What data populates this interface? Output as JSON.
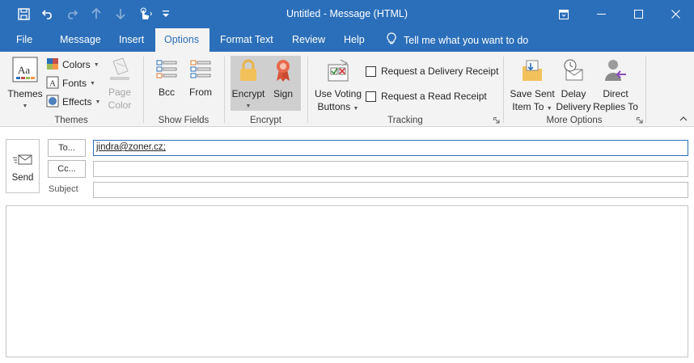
{
  "window": {
    "title": "Untitled  -  Message (HTML)"
  },
  "qat": {
    "icons": [
      "save-icon",
      "undo-icon",
      "redo-icon",
      "up-icon",
      "down-icon",
      "touch-mode-icon",
      "customize-icon"
    ]
  },
  "tabs": [
    {
      "label": "File"
    },
    {
      "label": "Message"
    },
    {
      "label": "Insert"
    },
    {
      "label": "Options"
    },
    {
      "label": "Format Text"
    },
    {
      "label": "Review"
    },
    {
      "label": "Help"
    }
  ],
  "tell_me": "Tell me what you want to do",
  "ribbon": {
    "themes_group": {
      "label": "Themes",
      "themes": "Themes",
      "colors": "Colors",
      "fonts": "Fonts",
      "effects": "Effects",
      "page_color_1": "Page",
      "page_color_2": "Color"
    },
    "show_fields_group": {
      "label": "Show Fields",
      "bcc": "Bcc",
      "from": "From"
    },
    "encrypt_group": {
      "label": "Encrypt",
      "encrypt": "Encrypt",
      "sign": "Sign"
    },
    "tracking_group": {
      "label": "Tracking",
      "voting_1": "Use Voting",
      "voting_2": "Buttons",
      "delivery_receipt": "Request a Delivery Receipt",
      "read_receipt": "Request a Read Receipt"
    },
    "more_options_group": {
      "label": "More Options",
      "save_sent_1": "Save Sent",
      "save_sent_2": "Item To",
      "delay_1": "Delay",
      "delay_2": "Delivery",
      "direct_1": "Direct",
      "direct_2": "Replies To"
    }
  },
  "compose": {
    "send": "Send",
    "to_button": "To...",
    "cc_button": "Cc...",
    "subject_label": "Subject",
    "to_value": "jindra@zoner.cz;",
    "cc_value": "",
    "subject_value": ""
  },
  "colors": {
    "accent": "#2b6fba",
    "ribbon_bg": "#f3f3f3"
  }
}
